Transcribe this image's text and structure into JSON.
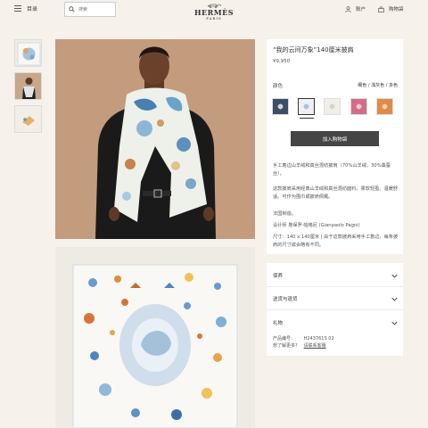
{
  "header": {
    "menu_label": "目录",
    "search_placeholder": "搜索",
    "brand": "HERMÈS",
    "city": "PARIS",
    "account_label": "账户",
    "cart_label": "购物袋"
  },
  "product": {
    "title": "“我的云间万象”140厘米披肩",
    "price": "¥9,950",
    "color_label": "颜色",
    "color_value": "细色 / 浅灰色 / 多色",
    "swatches": [
      {
        "name": "navy",
        "color": "#3d4e63"
      },
      {
        "name": "light-blue",
        "color": "#eef0f1"
      },
      {
        "name": "cream",
        "color": "#f1efe9"
      },
      {
        "name": "pink",
        "color": "#d36d88"
      },
      {
        "name": "orange",
        "color": "#df8b4b"
      }
    ],
    "add_to_cart": "加入购物袋",
    "description": [
      "手工着边山羊绒和真丝混纺披肩（70%山羊绒，30%桑蚕丝）。",
      "这款披肩采用经典山羊绒和真丝混纺面料，柔软轻盈、温暖舒适。可作为围巾或披肩佩戴。",
      "法国制造。",
      "设计师 詹保罗·帕格尼 (Gianpaolo Pagni)",
      "尺寸：140 x 140厘米 | 由于这款披肩采用手工着边，每条披肩的尺寸或会略有不同。"
    ]
  },
  "accordion": {
    "items": [
      "保养",
      "送货与退货",
      "礼物"
    ],
    "product_number_label": "产品编号：",
    "product_number": "H243761S 02",
    "help_prefix": "想了解更多？",
    "help_link": "请联系客服"
  },
  "colors": {
    "background": "#f6f1eb",
    "card": "#ffffff",
    "button": "#454545",
    "photo_bg": "#c39b7d"
  }
}
